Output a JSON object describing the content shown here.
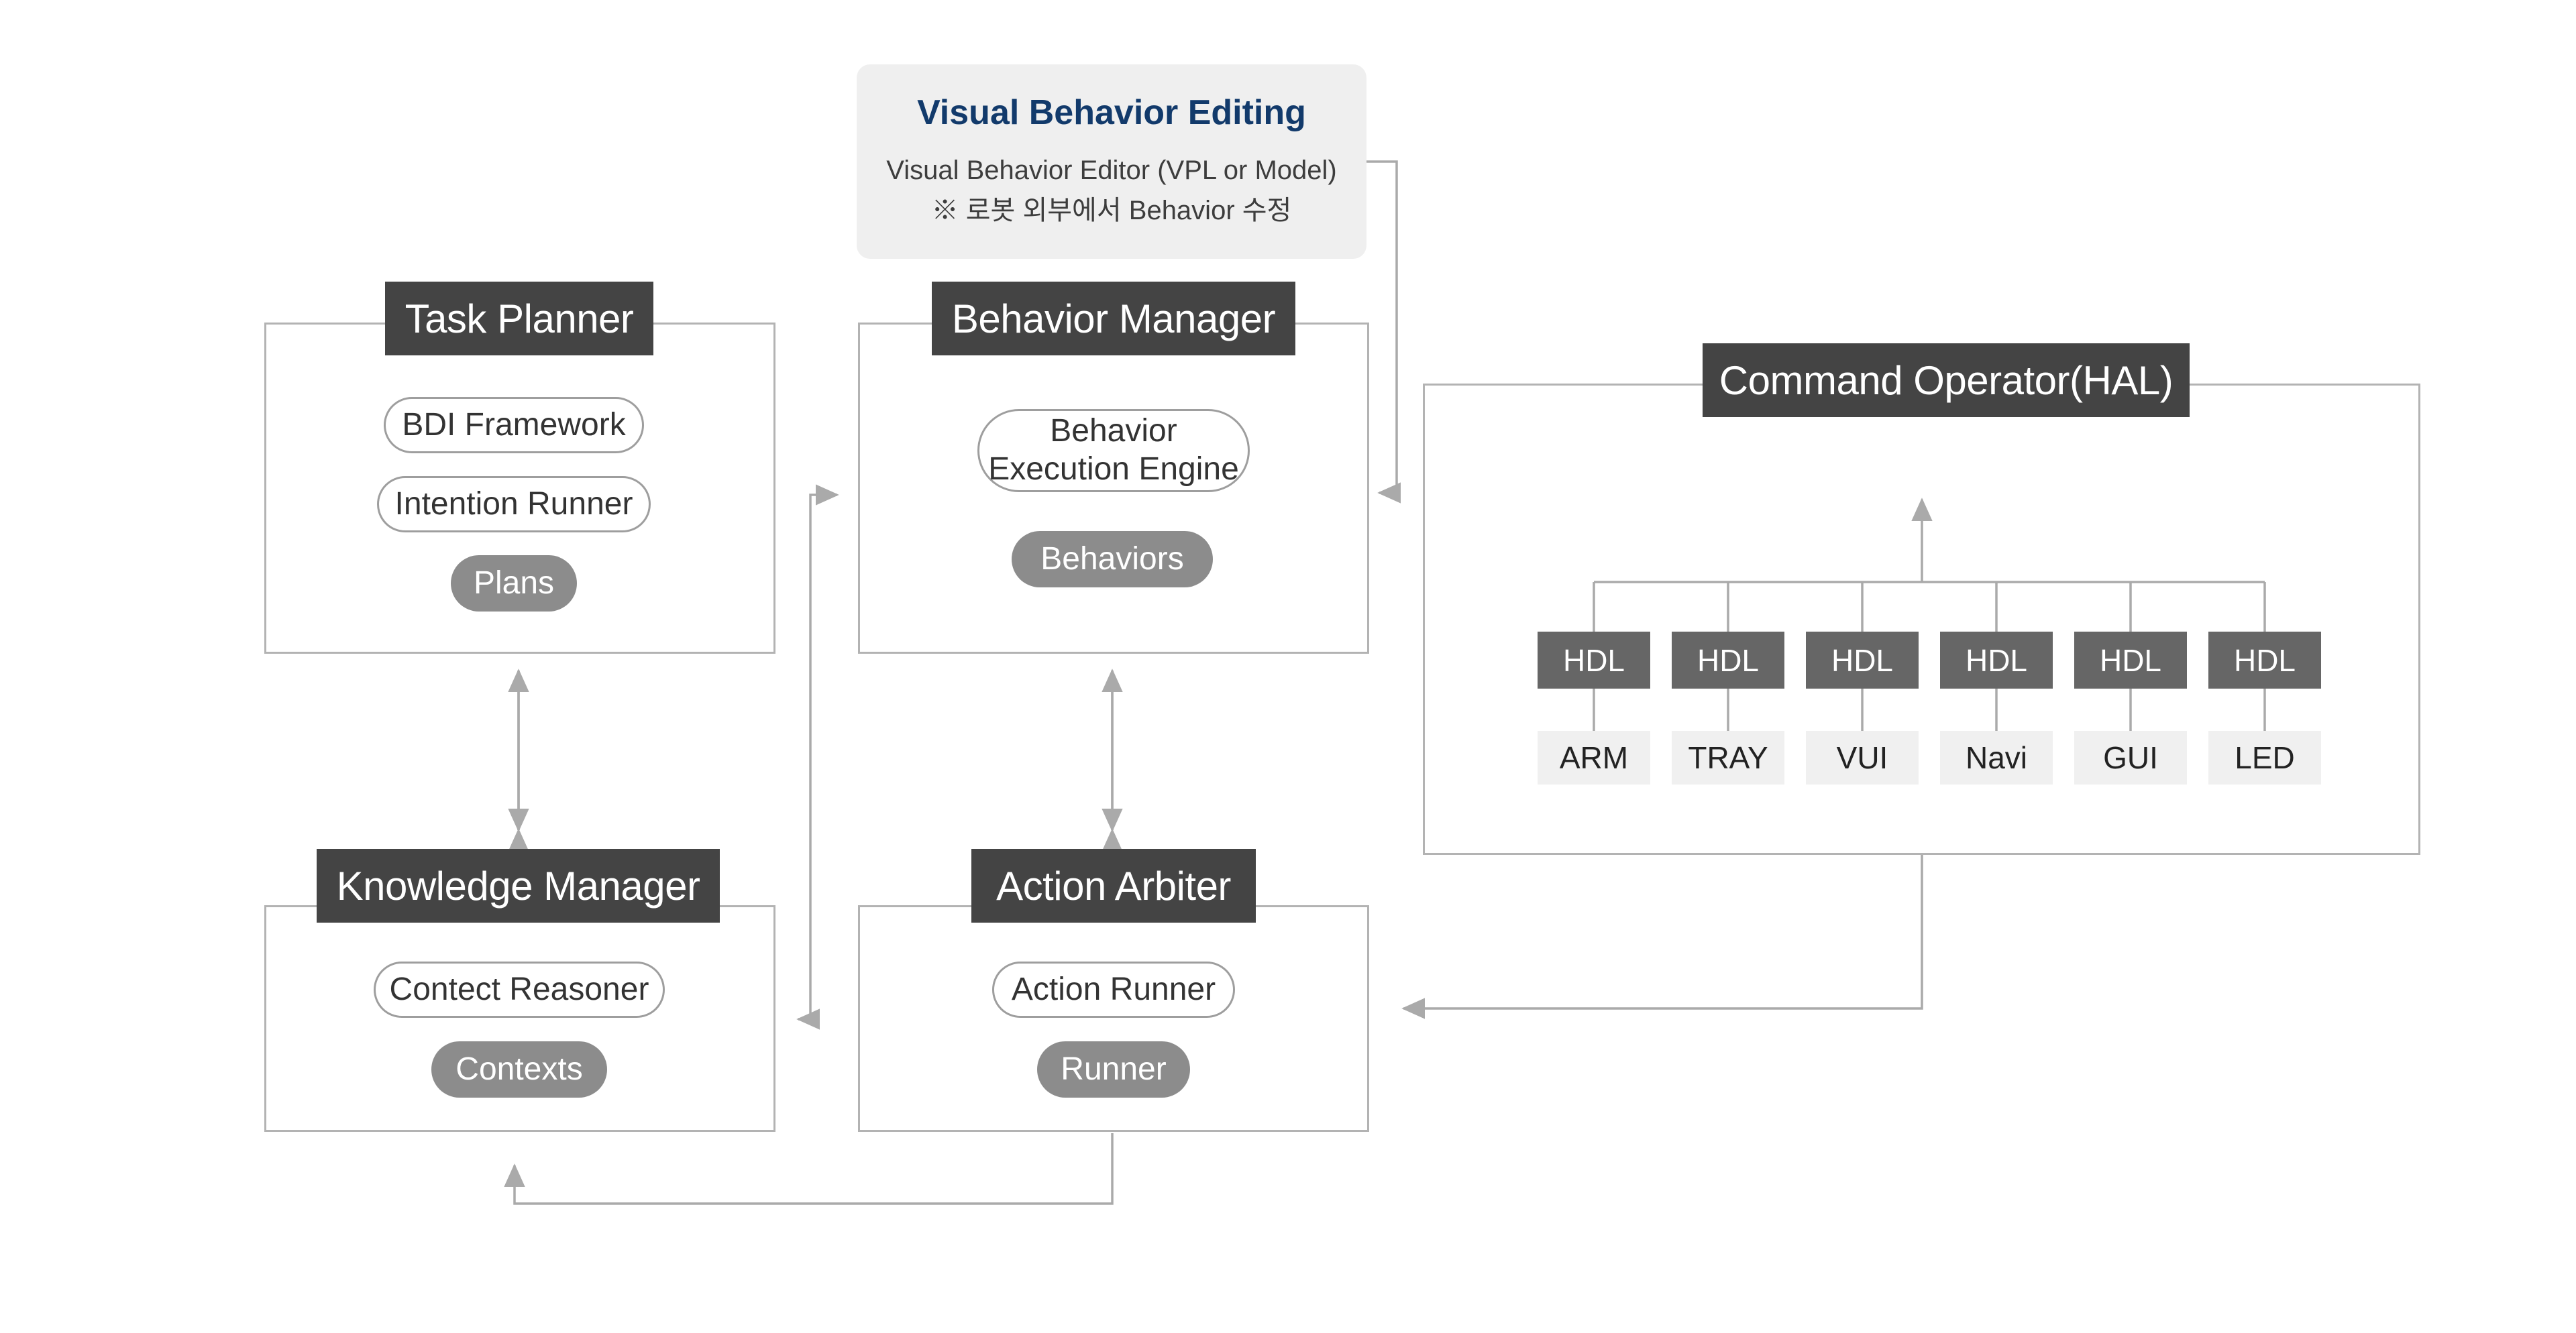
{
  "editor": {
    "title": "Visual Behavior Editing",
    "line1": "Visual Behavior Editor (VPL or Model)",
    "line2": "※ 로봇 외부에서 Behavior 수정"
  },
  "modules": {
    "task_planner": {
      "title": "Task Planner",
      "items": [
        {
          "label": "BDI Framework",
          "style": "outline"
        },
        {
          "label": "Intention Runner",
          "style": "outline"
        },
        {
          "label": "Plans",
          "style": "filled"
        }
      ]
    },
    "behavior_manager": {
      "title": "Behavior Manager",
      "items": [
        {
          "label": "Behavior\nExecution Engine",
          "style": "outline"
        },
        {
          "label": "Behaviors",
          "style": "filled"
        }
      ]
    },
    "knowledge_manager": {
      "title": "Knowledge Manager",
      "items": [
        {
          "label": "Contect Reasoner",
          "style": "outline"
        },
        {
          "label": "Contexts",
          "style": "filled"
        }
      ]
    },
    "action_arbiter": {
      "title": "Action Arbiter",
      "items": [
        {
          "label": "Action Runner",
          "style": "outline"
        },
        {
          "label": "Runner",
          "style": "filled"
        }
      ]
    },
    "command_operator": {
      "title": "Command Operator(HAL)",
      "hdl_label": "HDL",
      "devices": [
        "ARM",
        "TRAY",
        "VUI",
        "Navi",
        "GUI",
        "LED"
      ]
    }
  },
  "colors": {
    "header_bg": "#444444",
    "module_border": "#b3b3b3",
    "pill_fill": "#8c8c8c",
    "pill_outline_border": "#9e9e9e",
    "hdl_bg": "#666666",
    "device_bg": "#f0f0f0",
    "editor_bg": "#efefef",
    "editor_title": "#123a6b",
    "connector": "#aaaaaa"
  }
}
